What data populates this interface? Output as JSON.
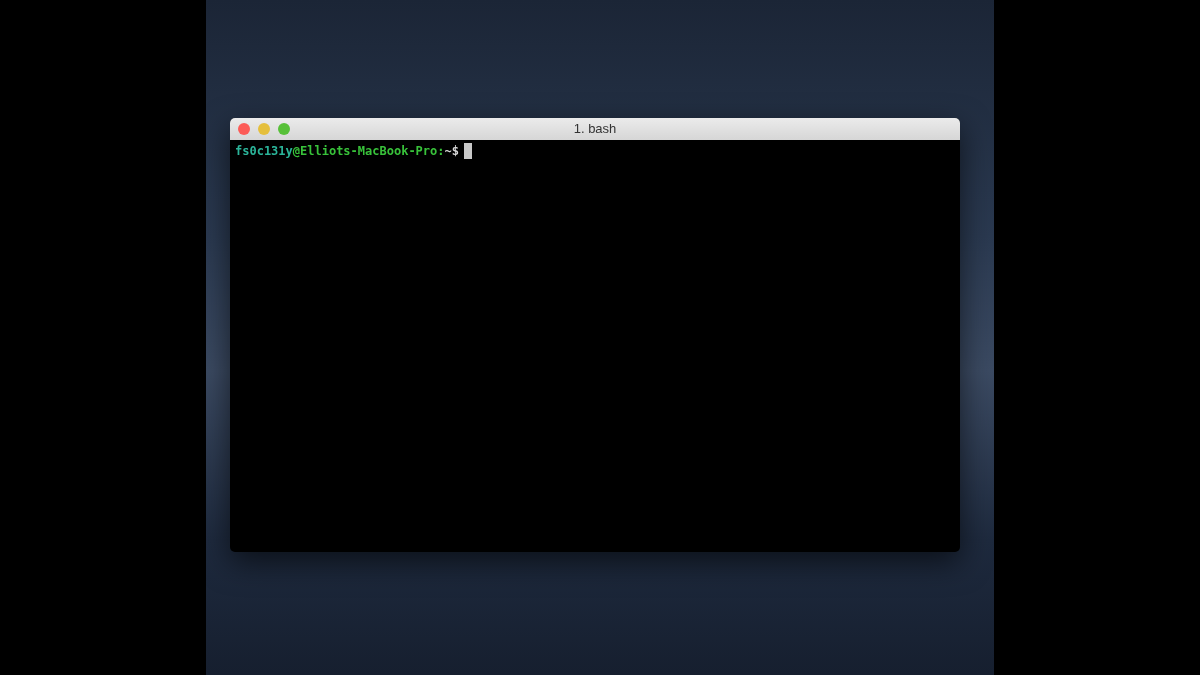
{
  "window": {
    "title": "1. bash"
  },
  "terminal": {
    "prompt": [
      {
        "text": "fs0c131y",
        "color": "#2bb59a"
      },
      {
        "text": "@Elliots-MacBook-Pro:",
        "color": "#38c23a"
      },
      {
        "text": "~$",
        "color": "#d8d8d8"
      }
    ],
    "cursor": true
  }
}
